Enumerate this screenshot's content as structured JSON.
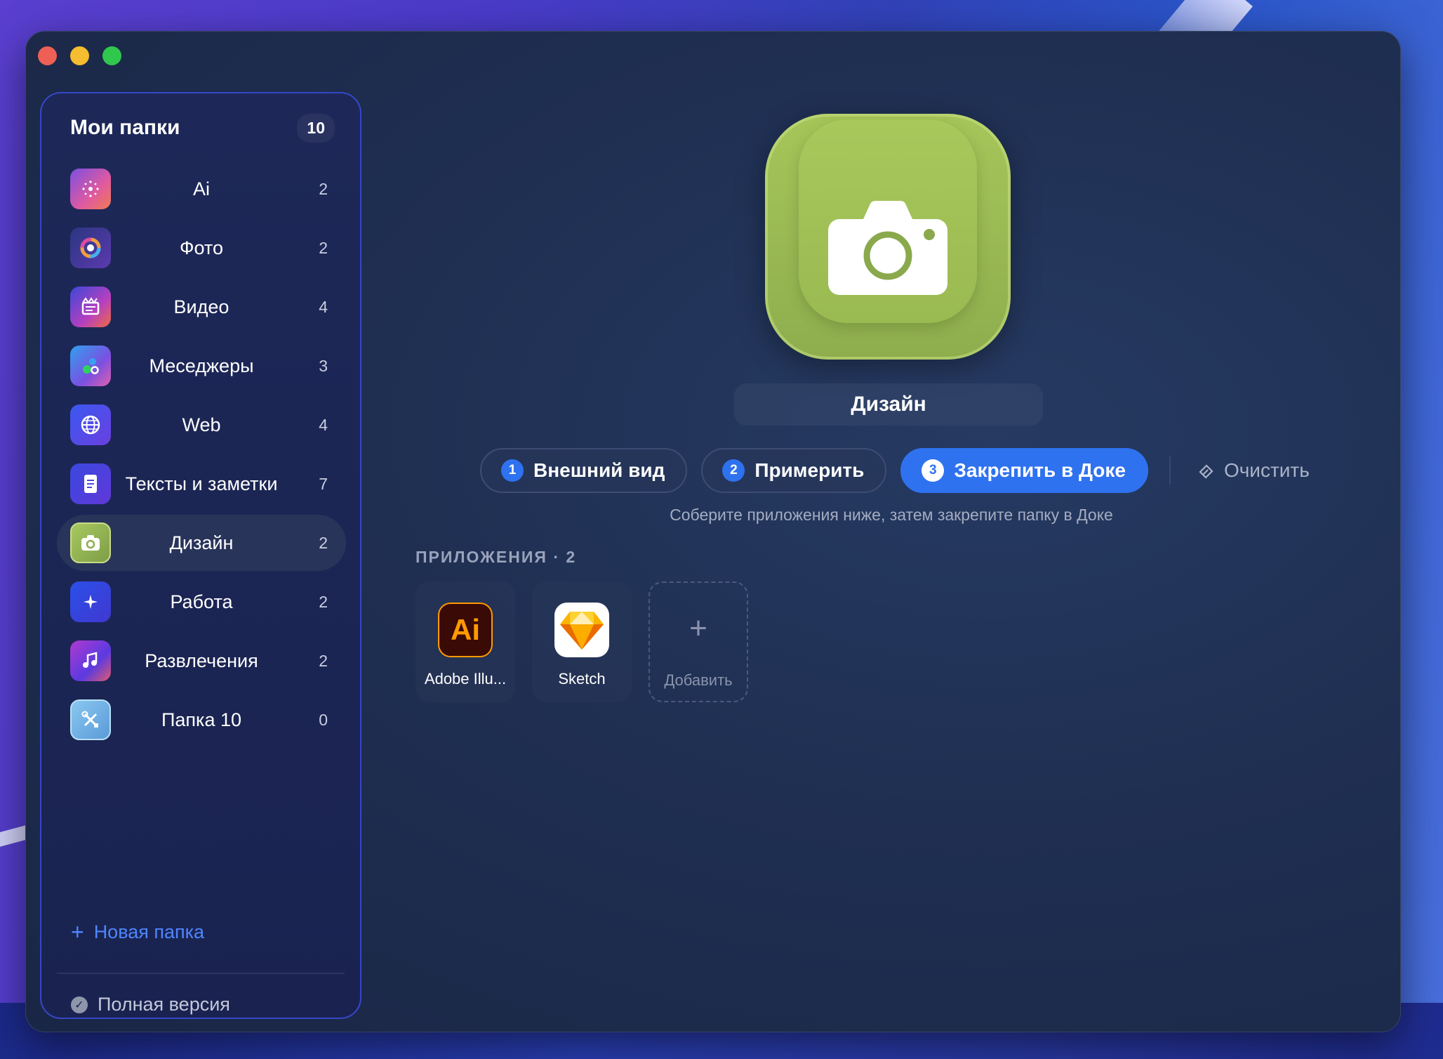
{
  "sidebar": {
    "title": "Мои папки",
    "count": "10",
    "folders": [
      {
        "label": "Ai",
        "count": "2",
        "icon": "sparkle-icon"
      },
      {
        "label": "Фото",
        "count": "2",
        "icon": "photo-icon"
      },
      {
        "label": "Видео",
        "count": "4",
        "icon": "video-icon"
      },
      {
        "label": "Меседжеры",
        "count": "3",
        "icon": "messenger-icon"
      },
      {
        "label": "Web",
        "count": "4",
        "icon": "globe-icon"
      },
      {
        "label": "Тексты и заметки",
        "count": "7",
        "icon": "document-icon"
      },
      {
        "label": "Дизайн",
        "count": "2",
        "icon": "camera-icon"
      },
      {
        "label": "Работа",
        "count": "2",
        "icon": "sparkle-icon"
      },
      {
        "label": "Развлечения",
        "count": "2",
        "icon": "music-icon"
      },
      {
        "label": "Папка 10",
        "count": "0",
        "icon": "tools-icon"
      }
    ],
    "new_folder": "Новая папка",
    "full_version": "Полная версия"
  },
  "main": {
    "folder_name": "Дизайн",
    "steps": [
      {
        "num": "1",
        "label": "Внешний вид"
      },
      {
        "num": "2",
        "label": "Примерить"
      },
      {
        "num": "3",
        "label": "Закрепить в Доке"
      }
    ],
    "clear": "Очистить",
    "hint": "Соберите приложения ниже, затем закрепите папку в Доке",
    "apps_title": "ПРИЛОЖЕНИЯ · 2",
    "apps": [
      {
        "label": "Adobe Illu...",
        "icon": "adobe-illustrator-icon",
        "icon_text": "Ai"
      },
      {
        "label": "Sketch",
        "icon": "sketch-icon"
      }
    ],
    "add_label": "Добавить"
  },
  "colors": {
    "accent": "#2f72f0",
    "folder_green": "#9aba52",
    "sidebar_border": "#3547c9"
  }
}
